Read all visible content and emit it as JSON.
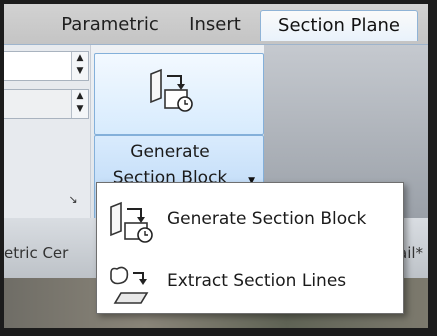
{
  "tabs": [
    {
      "label": "Parametric",
      "active": false
    },
    {
      "label": "Insert",
      "active": false
    },
    {
      "label": "Section Plane",
      "active": true
    }
  ],
  "ribbon": {
    "generate_button": {
      "line1": "Generate",
      "line2": "Section Block",
      "icon": "section-block-icon"
    },
    "panel_launcher_icon": "panel-launcher-icon"
  },
  "doc_tabs": {
    "left_partial": "etric Cer",
    "right_partial": "ail*"
  },
  "menu": {
    "items": [
      {
        "label": "Generate Section Block",
        "icon": "generate-section-block-icon"
      },
      {
        "label": "Extract Section Lines",
        "icon": "extract-section-lines-icon"
      }
    ]
  },
  "colors": {
    "active_tab_border": "#8fb3d6",
    "button_highlight": "#b8d6f5",
    "ribbon_bg": "#eef1f4"
  }
}
